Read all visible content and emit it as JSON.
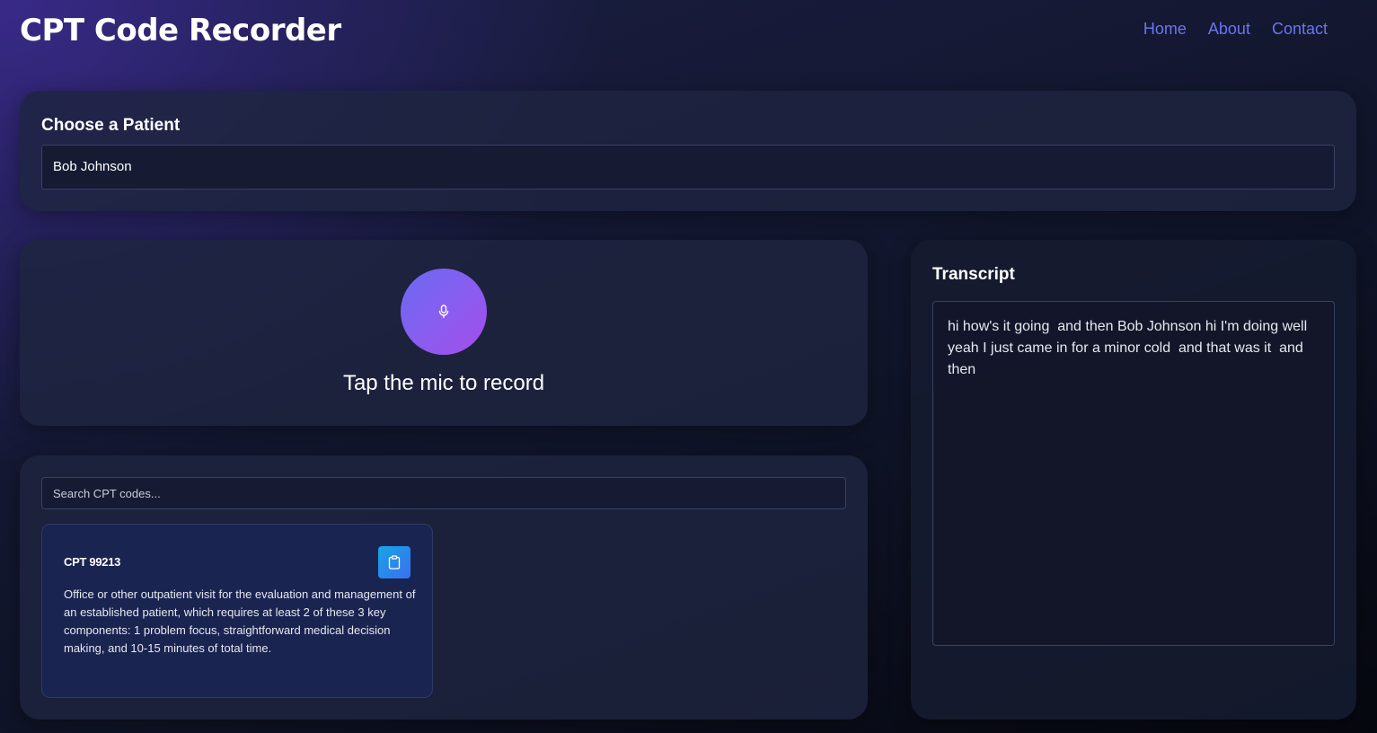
{
  "header": {
    "title": "CPT Code Recorder",
    "nav": [
      {
        "label": "Home"
      },
      {
        "label": "About"
      },
      {
        "label": "Contact"
      }
    ]
  },
  "patient": {
    "heading": "Choose a Patient",
    "selected": "Bob Johnson"
  },
  "recorder": {
    "hint": "Tap the mic to record",
    "icon": "microphone-icon"
  },
  "codes": {
    "search_placeholder": "Search CPT codes...",
    "items": [
      {
        "code": "CPT 99213",
        "description": "Office or other outpatient visit for the evaluation and management of an established patient, which requires at least 2 of these 3 key components: 1 problem focus, straightforward medical decision making, and 10-15 minutes of total time.",
        "action_icon": "clipboard-icon"
      }
    ]
  },
  "transcript": {
    "heading": "Transcript",
    "text": "hi how's it going  and then Bob Johnson hi I'm doing well yeah I just came in for a minor cold  and that was it  and then"
  },
  "colors": {
    "nav_link": "#6b74f0",
    "mic_gradient_start": "#6a6af2",
    "mic_gradient_end": "#a44de8",
    "copy_button_start": "#18a4e6",
    "copy_button_end": "#3b6ef0"
  }
}
